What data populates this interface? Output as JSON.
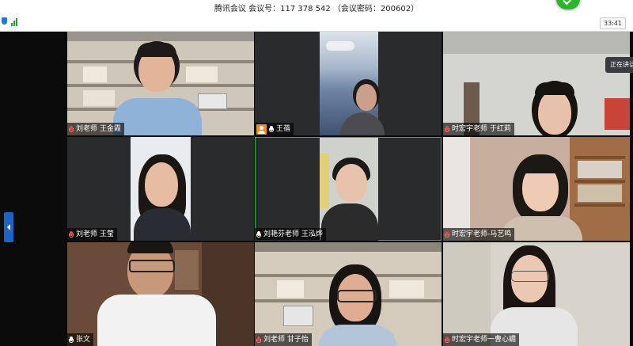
{
  "window": {
    "title": "腾讯会议 会议号：117 378 542 （会议密码：200602）"
  },
  "toolbar": {
    "timer": "33:41"
  },
  "speaking_tag": "正在讲话",
  "participants": [
    {
      "name": "刘老师  王金霞",
      "mic": "muted",
      "colors": {
        "bg": "#c9c2b6",
        "shirt": "#8fb2d8"
      }
    },
    {
      "name": "王蓓",
      "mic": "on",
      "colors": {
        "bg": "#93a7c4",
        "shirt": "#4c4c50"
      }
    },
    {
      "name": "时宏宇老师   于红莉",
      "mic": "muted",
      "colors": {
        "bg": "#d8d8d6",
        "shirt": "#e9e9e4"
      }
    },
    {
      "name": "刘老师  王莹",
      "mic": "muted",
      "colors": {
        "bg": "#e9ecef",
        "shirt": "#2a2c33"
      }
    },
    {
      "name": "刘艳芬老师 王泓烨",
      "mic": "on",
      "colors": {
        "bg": "#c9ccc7",
        "shirt": "#2b2b2b"
      }
    },
    {
      "name": "时宏宇老师-马艺鸣",
      "mic": "muted",
      "colors": {
        "bg": "#c4a99c",
        "shirt": "#cfbfae"
      }
    },
    {
      "name": "张文",
      "mic": "on",
      "colors": {
        "bg": "#7a5a45",
        "shirt": "#f2f2f2"
      }
    },
    {
      "name": "刘老师  甘子怡",
      "mic": "muted",
      "colors": {
        "bg": "#d4cbbd",
        "shirt": "#b3c6d8"
      }
    },
    {
      "name": "时宏宇老师一曹心媚",
      "mic": "muted",
      "colors": {
        "bg": "#d8d4cc",
        "shirt": "#e6e6e6"
      }
    }
  ]
}
